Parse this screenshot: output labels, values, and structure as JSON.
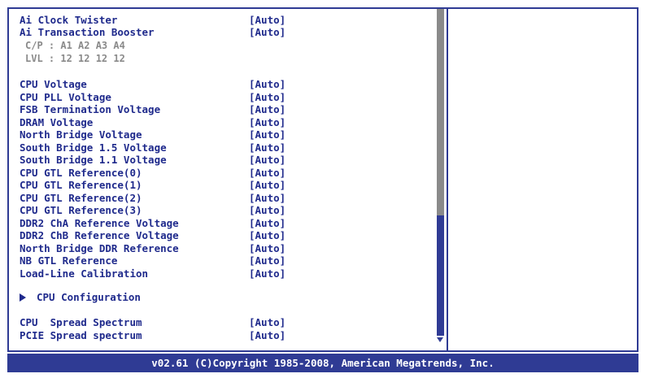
{
  "settings_top": [
    {
      "label": "Ai Clock Twister",
      "value": "[Auto]"
    },
    {
      "label": "Ai Transaction Booster",
      "value": "[Auto]"
    }
  ],
  "info_lines": [
    "C/P : A1 A2 A3 A4",
    "LVL : 12 12 12 12"
  ],
  "voltage_settings": [
    {
      "label": "CPU Voltage",
      "value": "[Auto]"
    },
    {
      "label": "CPU PLL Voltage",
      "value": "[Auto]"
    },
    {
      "label": "FSB Termination Voltage",
      "value": "[Auto]"
    },
    {
      "label": "DRAM Voltage",
      "value": "[Auto]"
    },
    {
      "label": "North Bridge Voltage",
      "value": "[Auto]"
    },
    {
      "label": "South Bridge 1.5 Voltage",
      "value": "[Auto]"
    },
    {
      "label": "South Bridge 1.1 Voltage",
      "value": "[Auto]"
    },
    {
      "label": "CPU GTL Reference(0)",
      "value": "[Auto]"
    },
    {
      "label": "CPU GTL Reference(1)",
      "value": "[Auto]"
    },
    {
      "label": "CPU GTL Reference(2)",
      "value": "[Auto]"
    },
    {
      "label": "CPU GTL Reference(3)",
      "value": "[Auto]"
    },
    {
      "label": "DDR2 ChA Reference Voltage",
      "value": "[Auto]"
    },
    {
      "label": "DDR2 ChB Reference Voltage",
      "value": "[Auto]"
    },
    {
      "label": "North Bridge DDR Reference",
      "value": "[Auto]"
    },
    {
      "label": "NB GTL Reference",
      "value": "[Auto]"
    },
    {
      "label": "Load-Line Calibration",
      "value": "[Auto]"
    }
  ],
  "submenu": {
    "label": "CPU Configuration"
  },
  "spread_settings": [
    {
      "label": "CPU  Spread Spectrum",
      "value": "[Auto]"
    },
    {
      "label": "PCIE Spread spectrum",
      "value": "[Auto]"
    }
  ],
  "footer": {
    "text": "v02.61 (C)Copyright 1985-2008, American Megatrends, Inc."
  },
  "colors": {
    "text": "#1f2a8c",
    "info_text": "#8a8a8a",
    "frame": "#2f3b94",
    "footer_bg": "#2f3b94",
    "scroll_gray": "#8a8a8a"
  }
}
